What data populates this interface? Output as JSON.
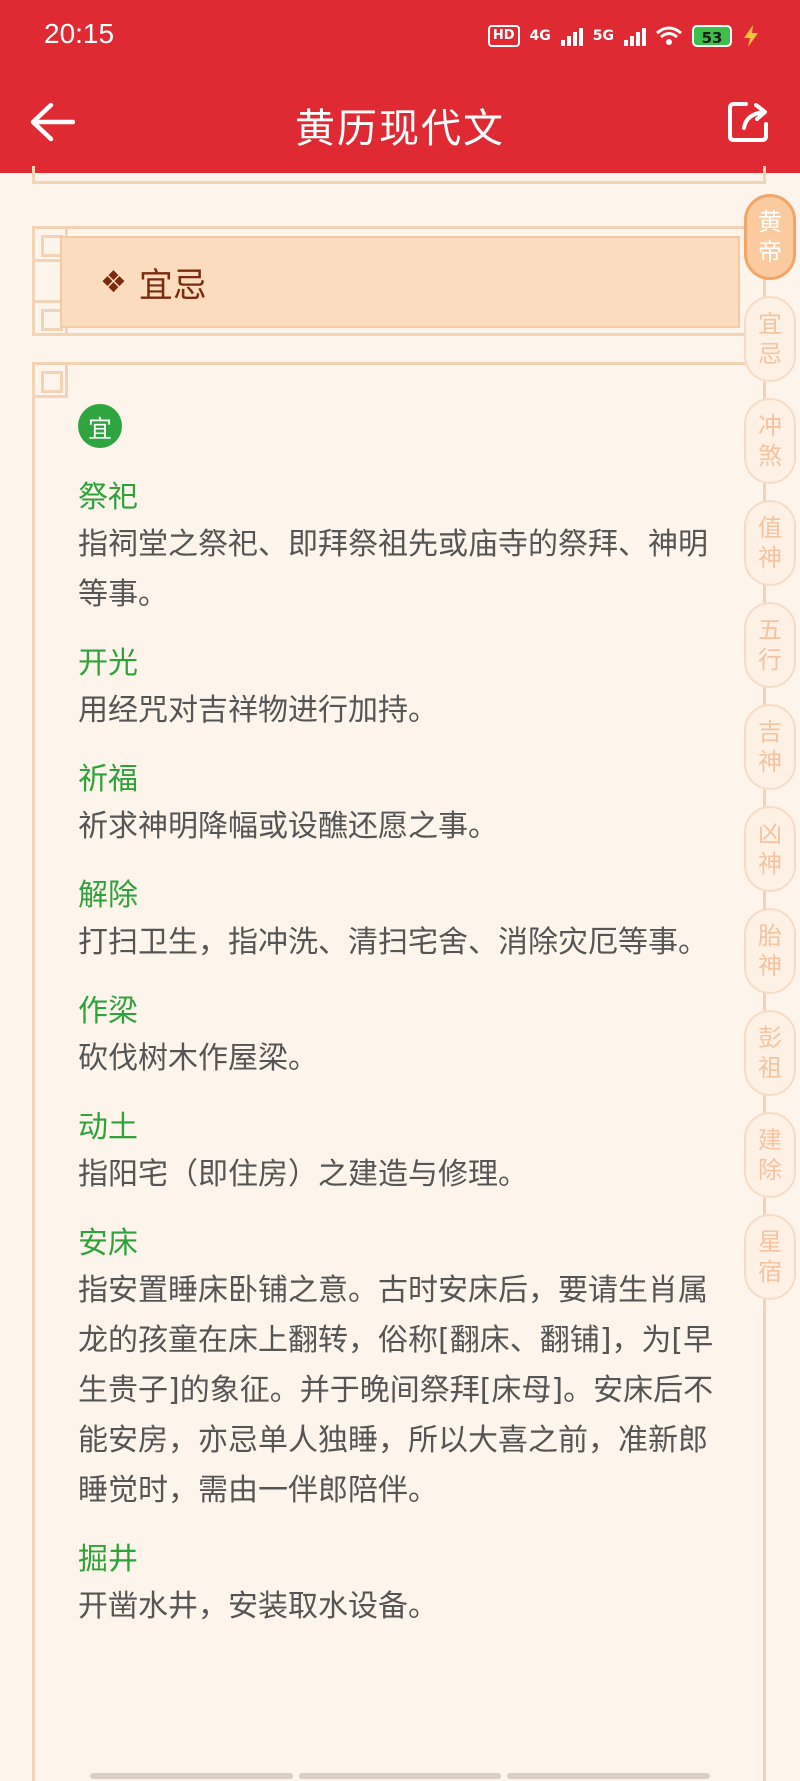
{
  "status_bar": {
    "time": "20:15",
    "network_1": "4G",
    "network_2": "5G",
    "battery": "53",
    "hd_label": "HD"
  },
  "app_bar": {
    "title": "黄历现代文",
    "back_icon": "back-arrow-icon",
    "share_icon": "share-icon"
  },
  "section": {
    "marker": "❖",
    "title": "宜忌",
    "badge": "宜"
  },
  "entries": [
    {
      "term": "祭祀",
      "desc": "指祠堂之祭祀、即拜祭祖先或庙寺的祭拜、神明等事。"
    },
    {
      "term": "开光",
      "desc": "用经咒对吉祥物进行加持。"
    },
    {
      "term": "祈福",
      "desc": "祈求神明降幅或设醮还愿之事。"
    },
    {
      "term": "解除",
      "desc": "打扫卫生，指冲洗、清扫宅舍、消除灾厄等事。"
    },
    {
      "term": "作梁",
      "desc": "砍伐树木作屋梁。"
    },
    {
      "term": "动土",
      "desc": "指阳宅（即住房）之建造与修理。"
    },
    {
      "term": "安床",
      "desc": "指安置睡床卧铺之意。古时安床后，要请生肖属龙的孩童在床上翻转，俗称[翻床、翻铺]，为[早生贵子]的象征。并于晚间祭拜[床母]。安床后不能安房，亦忌单人独睡，所以大喜之前，准新郎睡觉时，需由一伴郎陪伴。"
    },
    {
      "term": "掘井",
      "desc": "开凿水井，安装取水设备。"
    }
  ],
  "side_index": [
    {
      "c1": "黄",
      "c2": "帝",
      "active": true
    },
    {
      "c1": "宜",
      "c2": "忌",
      "active": false
    },
    {
      "c1": "冲",
      "c2": "煞",
      "active": false
    },
    {
      "c1": "值",
      "c2": "神",
      "active": false
    },
    {
      "c1": "五",
      "c2": "行",
      "active": false
    },
    {
      "c1": "吉",
      "c2": "神",
      "active": false
    },
    {
      "c1": "凶",
      "c2": "神",
      "active": false
    },
    {
      "c1": "胎",
      "c2": "神",
      "active": false
    },
    {
      "c1": "彭",
      "c2": "祖",
      "active": false
    },
    {
      "c1": "建",
      "c2": "除",
      "active": false
    },
    {
      "c1": "星",
      "c2": "宿",
      "active": false
    }
  ],
  "colors": {
    "app_bar": "#e02a33",
    "term_green": "#2fa33a",
    "badge_green": "#2ea53e",
    "header_text": "#7b2a0e",
    "header_bg": "#fbdcbf",
    "page_bg": "#fdf4eb"
  }
}
